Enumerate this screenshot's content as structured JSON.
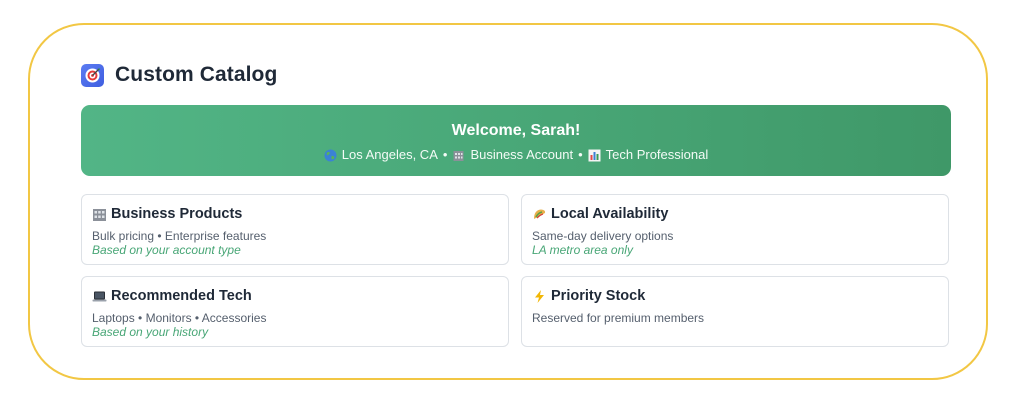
{
  "app": {
    "title": "Custom Catalog",
    "icon": "dart-target-icon"
  },
  "banner": {
    "welcome": "Welcome, Sarah!",
    "location": "Los Angeles, CA",
    "account": "Business Account",
    "profile": "Tech Professional",
    "separator": "•",
    "colors": {
      "start": "#52b586",
      "end": "#3f9868"
    }
  },
  "cards": [
    {
      "icon": "office-building-icon",
      "title": "Business Products",
      "desc": "Bulk pricing • Enterprise features",
      "note": "Based on your account type"
    },
    {
      "icon": "taco-icon",
      "title": "Local Availability",
      "desc": "Same-day delivery options",
      "note": "LA metro area only"
    },
    {
      "icon": "laptop-icon",
      "title": "Recommended Tech",
      "desc": "Laptops • Monitors • Accessories",
      "note": "Based on your history"
    },
    {
      "icon": "lightning-icon",
      "title": "Priority Stock",
      "desc": "Reserved for premium members",
      "note": ""
    }
  ],
  "colors": {
    "frame_border": "#f2c744",
    "accent_green": "#48a676",
    "title_text": "#1f2937"
  }
}
